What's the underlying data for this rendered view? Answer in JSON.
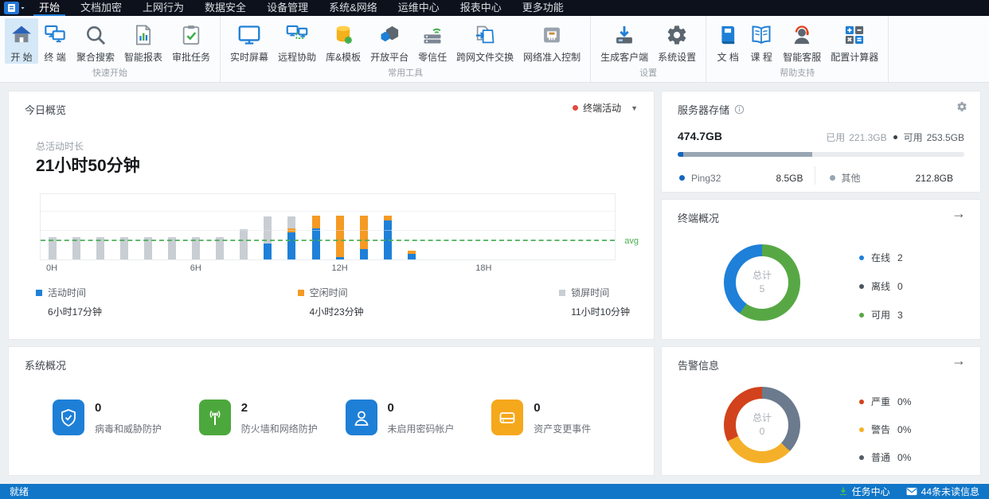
{
  "menu": {
    "tabs": [
      {
        "label": "开始",
        "active": true
      },
      {
        "label": "文档加密"
      },
      {
        "label": "上网行为"
      },
      {
        "label": "数据安全"
      },
      {
        "label": "设备管理"
      },
      {
        "label": "系统&网络"
      },
      {
        "label": "运维中心"
      },
      {
        "label": "报表中心"
      },
      {
        "label": "更多功能"
      }
    ]
  },
  "ribbon": {
    "groups": [
      {
        "label": "快速开始",
        "items": [
          {
            "label": "开 始",
            "icon": "home-icon",
            "active": true
          },
          {
            "label": "终 端",
            "icon": "terminal-icon"
          },
          {
            "label": "聚合搜索",
            "icon": "search-icon"
          },
          {
            "label": "智能报表",
            "icon": "report-icon"
          },
          {
            "label": "审批任务",
            "icon": "task-icon"
          }
        ]
      },
      {
        "label": "常用工具",
        "items": [
          {
            "label": "实时屏幕",
            "icon": "screen-icon"
          },
          {
            "label": "远程协助",
            "icon": "remote-icon"
          },
          {
            "label": "库&模板",
            "icon": "library-icon"
          },
          {
            "label": "开放平台",
            "icon": "platform-icon"
          },
          {
            "label": "零信任",
            "icon": "zerotrust-icon"
          },
          {
            "label": "跨网文件交换",
            "icon": "exchange-icon"
          },
          {
            "label": "网络准入控制",
            "icon": "nac-icon"
          }
        ]
      },
      {
        "label": "设置",
        "items": [
          {
            "label": "生成客户端",
            "icon": "client-icon"
          },
          {
            "label": "系统设置",
            "icon": "gear-icon"
          }
        ]
      },
      {
        "label": "帮助支持",
        "items": [
          {
            "label": "文 档",
            "icon": "book-icon"
          },
          {
            "label": "课 程",
            "icon": "course-icon"
          },
          {
            "label": "智能客服",
            "icon": "service-icon"
          },
          {
            "label": "配置计算器",
            "icon": "calculator-icon"
          }
        ]
      }
    ]
  },
  "panels": {
    "today": {
      "title": "今日概览",
      "filter_label": "终端活动",
      "stat_label": "总活动时长",
      "stat_value": "21小时50分钟"
    },
    "storage": {
      "title": "服务器存储",
      "total": "474.7GB",
      "used_label": "已用",
      "used_value": "221.3GB",
      "free_label": "可用",
      "free_value": "253.5GB",
      "legend": [
        {
          "name": "Ping32",
          "value": "8.5GB",
          "color": "#1565c0"
        },
        {
          "name": "其他",
          "value": "212.8GB",
          "color": "#98a5b2"
        }
      ]
    },
    "terminal": {
      "title": "终端概况"
    },
    "system": {
      "title": "系统概况",
      "items": [
        {
          "count": "0",
          "label": "病毒和威胁防护",
          "icon": "shield-check-icon",
          "color": "#1e7fd6"
        },
        {
          "count": "2",
          "label": "防火墙和网络防护",
          "icon": "signal-icon",
          "color": "#4ca83c"
        },
        {
          "count": "0",
          "label": "未启用密码帐户",
          "icon": "user-icon",
          "color": "#1e7fd6"
        },
        {
          "count": "0",
          "label": "资产变更事件",
          "icon": "asset-icon",
          "color": "#f5a81c"
        }
      ]
    },
    "alarm": {
      "title": "告警信息"
    }
  },
  "chart_data": [
    {
      "id": "terminal-activity",
      "type": "bar",
      "stacked": true,
      "title": "今日概览 · 终端活动",
      "x_unit": "hour",
      "hours": 24,
      "x_ticks": [
        "0H",
        "6H",
        "12H",
        "18H"
      ],
      "x_tick_hours": [
        0,
        6,
        12,
        18
      ],
      "y_unit": "percent_of_chart_height",
      "series": [
        {
          "name": "活动时间",
          "color": "#1e80d8",
          "total": "6小时17分钟",
          "values": [
            0,
            0,
            0,
            0,
            0,
            0,
            0,
            0,
            0,
            24,
            42,
            48,
            4,
            16,
            60,
            9,
            0,
            0,
            0,
            0,
            0,
            0,
            0,
            0
          ]
        },
        {
          "name": "空闲时间",
          "color": "#f59a23",
          "total": "4小时23分钟",
          "values": [
            0,
            0,
            0,
            0,
            0,
            0,
            0,
            0,
            0,
            0,
            6,
            19,
            63,
            51,
            7,
            4,
            0,
            0,
            0,
            0,
            0,
            0,
            0,
            0
          ]
        },
        {
          "name": "锁屏时间",
          "color": "#c9ced4",
          "total": "11小时10分钟",
          "values": [
            34,
            34,
            34,
            34,
            34,
            34,
            34,
            34,
            46,
            42,
            18,
            0,
            0,
            0,
            0,
            0,
            0,
            0,
            0,
            0,
            0,
            0,
            0,
            0
          ]
        }
      ],
      "avg_line": {
        "pct": 28,
        "label": "avg",
        "color": "#47ad52"
      },
      "gridlines_pct_from_top": [
        25,
        55
      ],
      "legend_position": "bottom"
    },
    {
      "id": "terminal-status",
      "type": "pie",
      "donut": true,
      "center_label": "总计",
      "center_value": "5",
      "slices": [
        {
          "name": "可用",
          "value": 3,
          "color": "#57a845"
        },
        {
          "name": "在线",
          "value": 2,
          "color": "#1e80d8"
        }
      ],
      "legend": [
        {
          "name": "在线",
          "value": "2",
          "color": "#1e80d8"
        },
        {
          "name": "离线",
          "value": "0",
          "color": "#4a5560"
        },
        {
          "name": "可用",
          "value": "3",
          "color": "#57a845"
        }
      ],
      "legend_position": "right"
    },
    {
      "id": "alarm-levels",
      "type": "pie",
      "donut": true,
      "center_label": "总计",
      "center_value": "0",
      "slices": [
        {
          "name": "普通",
          "pct": 37,
          "color": "#6b7a8d"
        },
        {
          "name": "警告",
          "pct": 31,
          "color": "#f5b02a"
        },
        {
          "name": "严重",
          "pct": 32,
          "color": "#d2421c"
        }
      ],
      "legend": [
        {
          "name": "严重",
          "value": "0%",
          "color": "#d2421c"
        },
        {
          "name": "警告",
          "value": "0%",
          "color": "#f5b02a"
        },
        {
          "name": "普通",
          "value": "0%",
          "color": "#555c66"
        }
      ],
      "legend_position": "right"
    },
    {
      "id": "server-storage",
      "type": "bar",
      "variant": "progress",
      "total": "474.7GB",
      "used": "221.3GB",
      "free": "253.5GB",
      "segments": [
        {
          "name": "Ping32",
          "value": "8.5GB",
          "pct": 2,
          "color": "#1565c0"
        },
        {
          "name": "其他",
          "value": "212.8GB",
          "pct": 45,
          "color": "#98a5b2"
        },
        {
          "name": "可用",
          "value": "253.5GB",
          "pct": 53,
          "color": "#e9ebee"
        }
      ]
    }
  ],
  "statusbar": {
    "ready": "就绪",
    "task_center": "任务中心",
    "unread": "44条未读信息"
  },
  "colors": {
    "accent_blue": "#1e80d8",
    "idle_orange": "#f59a23",
    "lock_gray": "#c9ced4",
    "avg_green": "#47ad52",
    "statusbar_blue": "#1176c8",
    "menubar_dark": "#0c111c"
  }
}
